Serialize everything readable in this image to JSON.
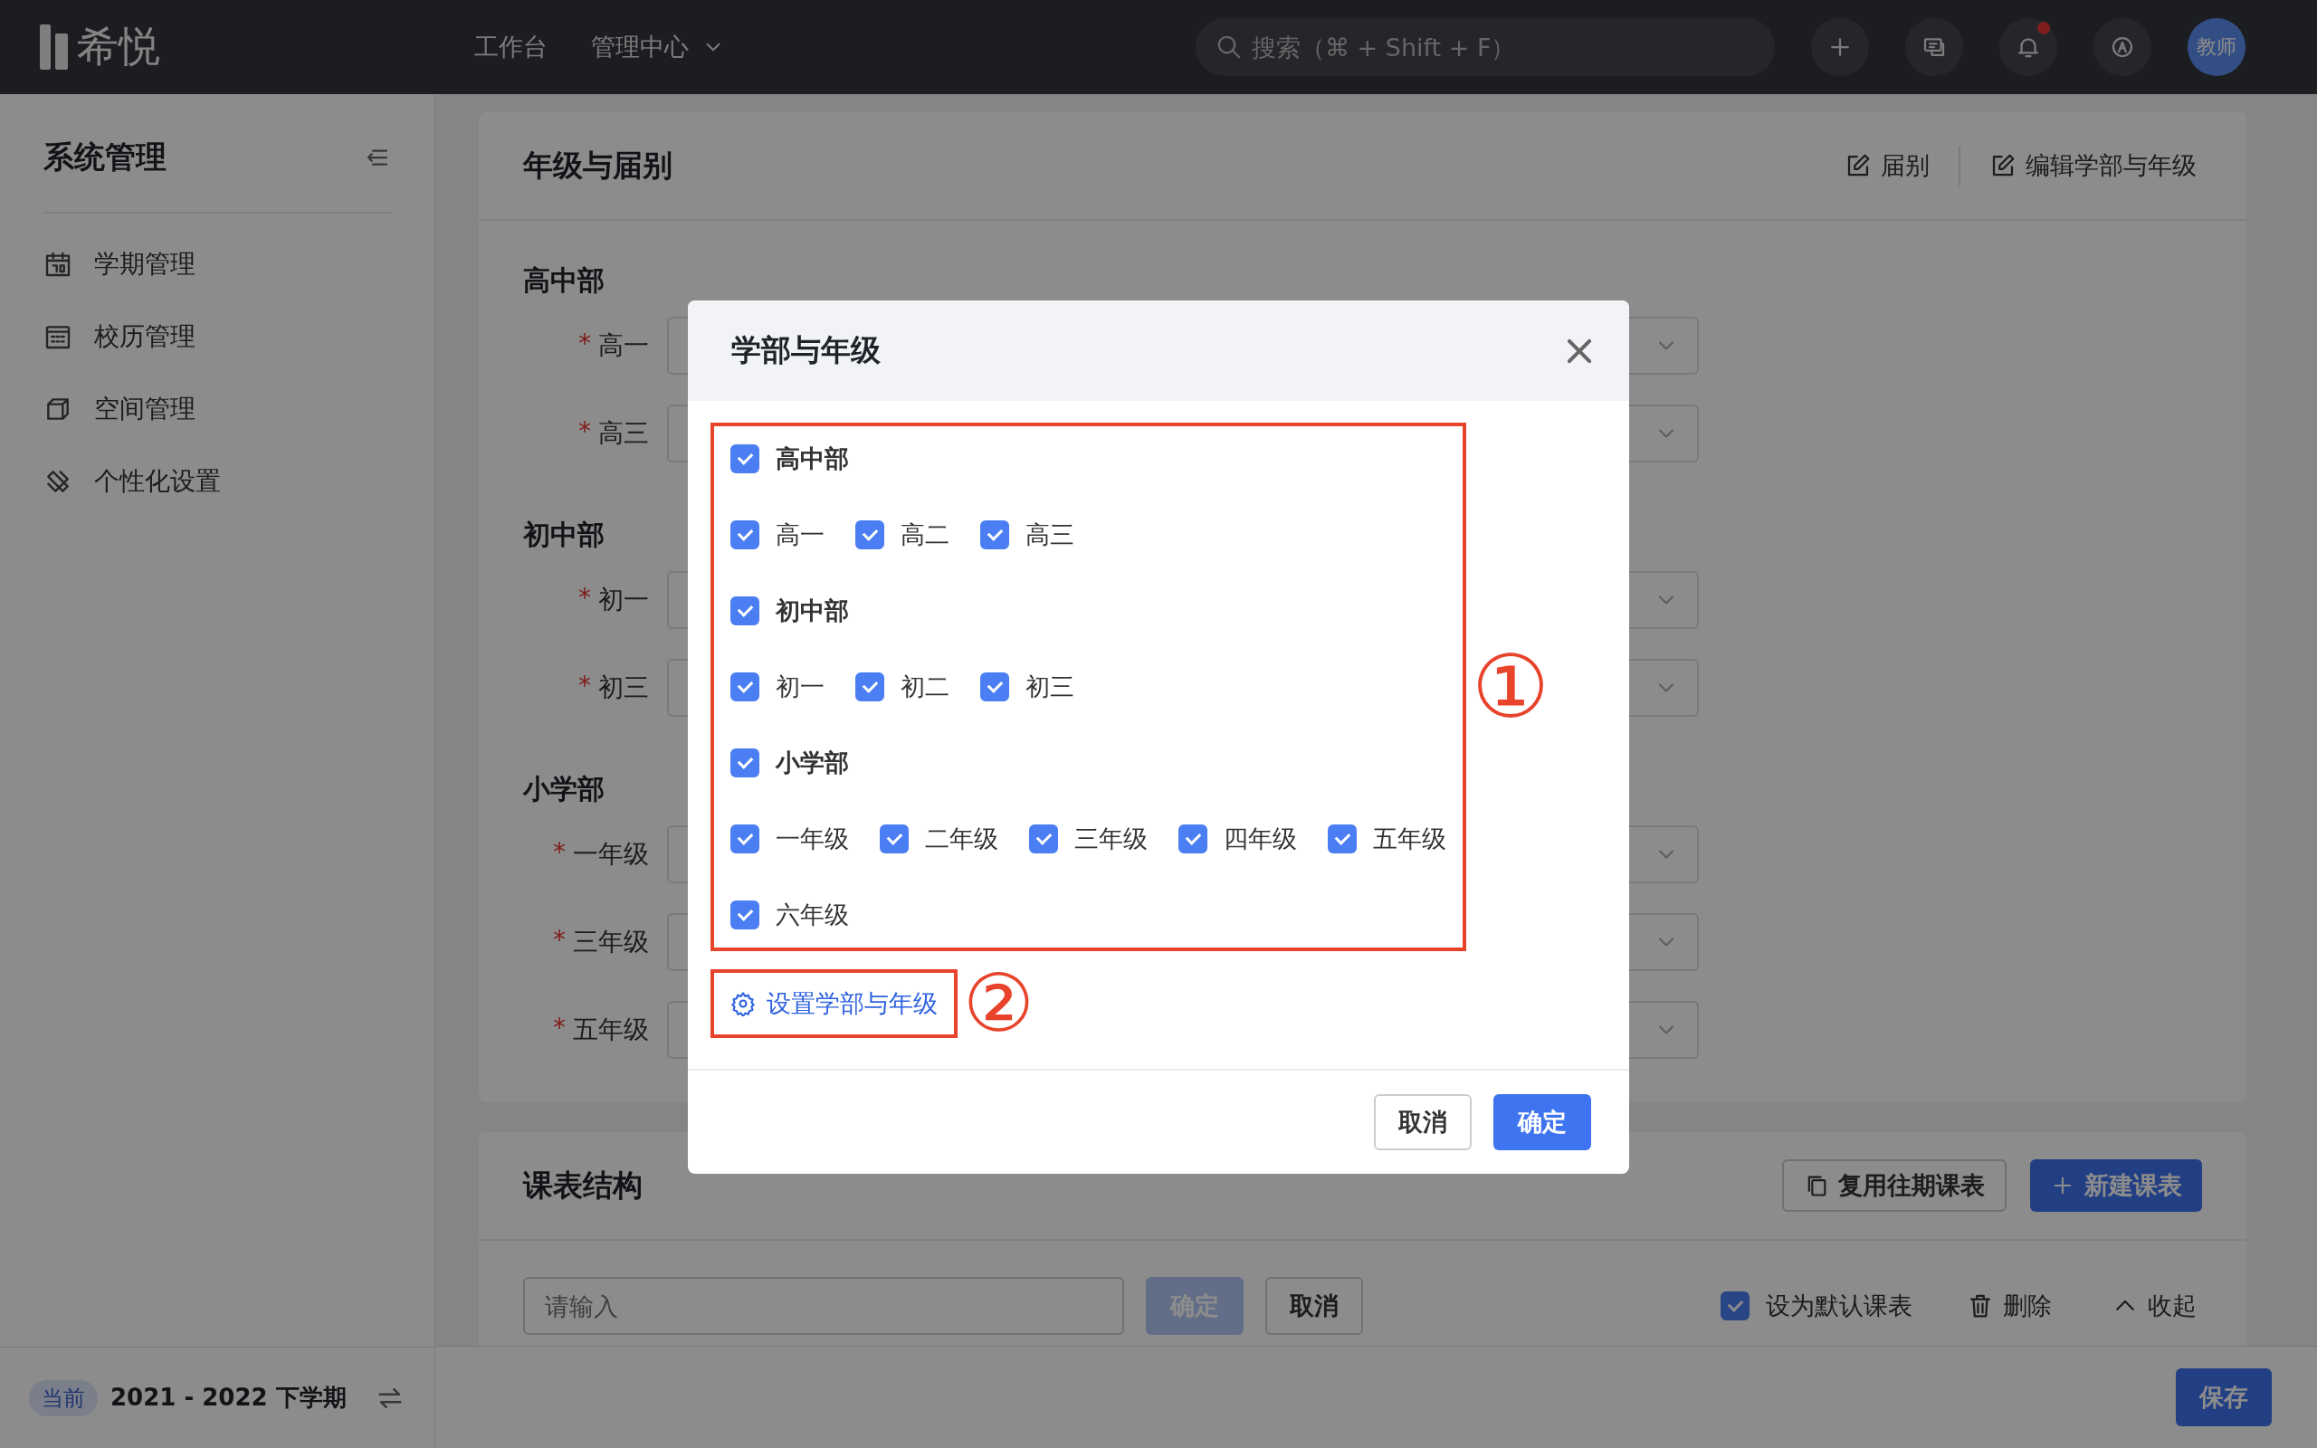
{
  "topbar": {
    "logo": "希悦",
    "nav": [
      {
        "label": "工作台",
        "kind": "link"
      },
      {
        "label": "管理中心",
        "kind": "dropdown"
      }
    ],
    "search": {
      "placeholder": "搜索（⌘ + Shift + F）"
    },
    "tools": [
      {
        "kind": "plus"
      },
      {
        "kind": "message"
      },
      {
        "kind": "bell",
        "has_notification": true
      },
      {
        "kind": "compass"
      }
    ],
    "avatar": "教师"
  },
  "sidebar": {
    "title": "系统管理",
    "items": [
      {
        "label": "学期管理"
      },
      {
        "label": "校历管理"
      },
      {
        "label": "空间管理"
      },
      {
        "label": "个性化设置"
      }
    ],
    "term_badge": "当前",
    "term": "2021 - 2022 下学期"
  },
  "grade_card": {
    "title": "年级与届别",
    "actions": [
      "届别",
      "编辑学部与年级"
    ],
    "sections": [
      {
        "name": "高中部",
        "rows": [
          {
            "label": "高一",
            "required_mark": "*"
          },
          {
            "label": "高三",
            "required_mark": "*"
          }
        ]
      },
      {
        "name": "初中部",
        "rows": [
          {
            "label": "初一",
            "required_mark": "*"
          },
          {
            "label": "初三",
            "required_mark": "*"
          }
        ]
      },
      {
        "name": "小学部",
        "rows": [
          {
            "label": "一年级",
            "required_mark": "*"
          },
          {
            "label": "三年级",
            "required_mark": "*"
          },
          {
            "label": "五年级",
            "required_mark": "*"
          }
        ]
      }
    ]
  },
  "schedule_card": {
    "title": "课表结构",
    "actions": [
      {
        "label": "复用往期课表",
        "kind": "outline"
      },
      {
        "label": "新建课表",
        "kind": "primary"
      }
    ],
    "input": {
      "placeholder": "请输入"
    },
    "confirm": {
      "label": "确定",
      "disabled": true
    },
    "cancel": "取消",
    "default_check": {
      "label": "设为默认课表",
      "checked": true
    },
    "delete": "删除",
    "collapse": "收起"
  },
  "save_button": "保存",
  "dialog": {
    "title": "学部与年级",
    "groups": [
      {
        "name": "高中部",
        "checked": true,
        "grades": [
          {
            "label": "高一",
            "checked": true
          },
          {
            "label": "高二",
            "checked": true
          },
          {
            "label": "高三",
            "checked": true
          }
        ]
      },
      {
        "name": "初中部",
        "checked": true,
        "grades": [
          {
            "label": "初一",
            "checked": true
          },
          {
            "label": "初二",
            "checked": true
          },
          {
            "label": "初三",
            "checked": true
          }
        ]
      },
      {
        "name": "小学部",
        "checked": true,
        "grades": [
          {
            "label": "一年级",
            "checked": true
          },
          {
            "label": "二年级",
            "checked": true
          },
          {
            "label": "三年级",
            "checked": true
          },
          {
            "label": "四年级",
            "checked": true
          },
          {
            "label": "五年级",
            "checked": true
          },
          {
            "label": "六年级",
            "checked": true
          }
        ]
      }
    ],
    "settings_link": "设置学部与年级",
    "annotations": [
      "①",
      "②"
    ],
    "cancel": "取消",
    "ok": "确定"
  }
}
